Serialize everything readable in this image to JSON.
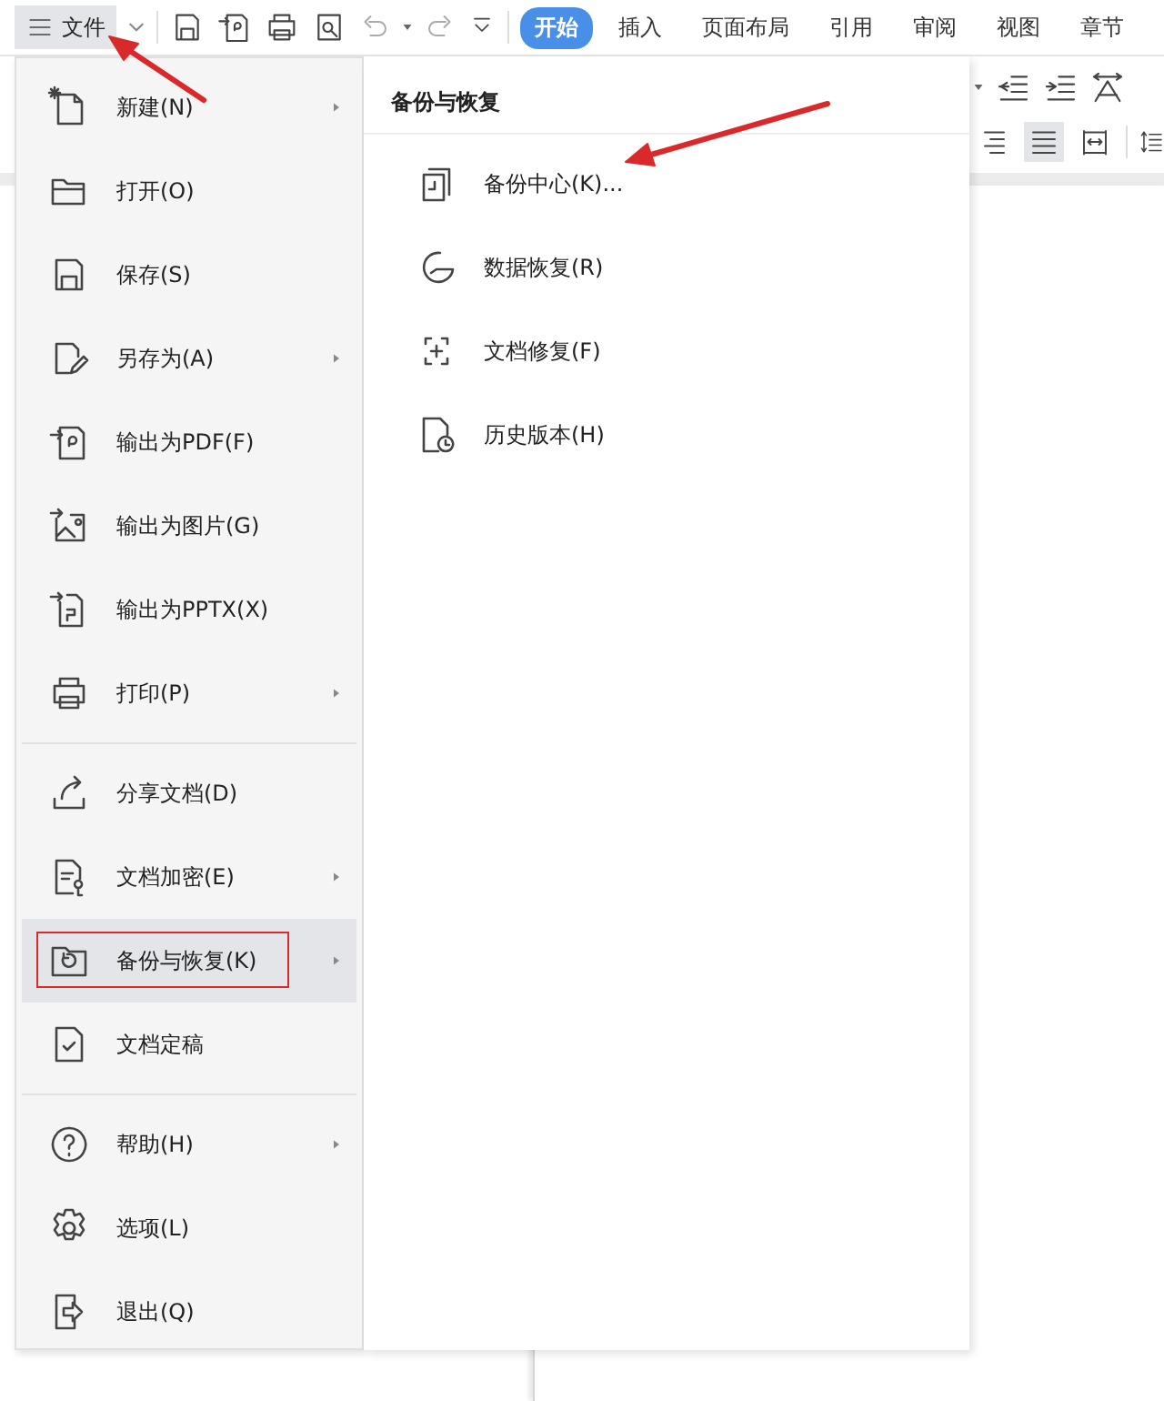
{
  "toolbar": {
    "file_menu": "文件",
    "tabs": [
      {
        "label": "开始",
        "selected": true
      },
      {
        "label": "插入",
        "selected": false
      },
      {
        "label": "页面布局",
        "selected": false
      },
      {
        "label": "引用",
        "selected": false
      },
      {
        "label": "审阅",
        "selected": false
      },
      {
        "label": "视图",
        "selected": false
      },
      {
        "label": "章节",
        "selected": false
      }
    ]
  },
  "paragraph_buttons": [
    {
      "selected": false
    },
    {
      "selected": true
    },
    {
      "selected": false
    }
  ],
  "file_menu": {
    "groups": [
      [
        {
          "label": "新建(N)",
          "has_submenu": true,
          "selected": false,
          "annotated": false
        },
        {
          "label": "打开(O)",
          "has_submenu": false,
          "selected": false,
          "annotated": false
        },
        {
          "label": "保存(S)",
          "has_submenu": false,
          "selected": false,
          "annotated": false
        },
        {
          "label": "另存为(A)",
          "has_submenu": true,
          "selected": false,
          "annotated": false
        },
        {
          "label": "输出为PDF(F)",
          "has_submenu": false,
          "selected": false,
          "annotated": false
        },
        {
          "label": "输出为图片(G)",
          "has_submenu": false,
          "selected": false,
          "annotated": false
        },
        {
          "label": "输出为PPTX(X)",
          "has_submenu": false,
          "selected": false,
          "annotated": false
        },
        {
          "label": "打印(P)",
          "has_submenu": true,
          "selected": false,
          "annotated": false
        }
      ],
      [
        {
          "label": "分享文档(D)",
          "has_submenu": false,
          "selected": false,
          "annotated": false
        },
        {
          "label": "文档加密(E)",
          "has_submenu": true,
          "selected": false,
          "annotated": false
        },
        {
          "label": "备份与恢复(K)",
          "has_submenu": true,
          "selected": true,
          "annotated": true
        },
        {
          "label": "文档定稿",
          "has_submenu": false,
          "selected": false,
          "annotated": false
        }
      ],
      [
        {
          "label": "帮助(H)",
          "has_submenu": true,
          "selected": false,
          "annotated": false
        },
        {
          "label": "选项(L)",
          "has_submenu": false,
          "selected": false,
          "annotated": false
        },
        {
          "label": "退出(Q)",
          "has_submenu": false,
          "selected": false,
          "annotated": false
        }
      ]
    ]
  },
  "submenu": {
    "title": "备份与恢复",
    "items": [
      {
        "label": "备份中心(K)..."
      },
      {
        "label": "数据恢复(R)"
      },
      {
        "label": "文档修复(F)"
      },
      {
        "label": "历史版本(H)"
      }
    ]
  }
}
